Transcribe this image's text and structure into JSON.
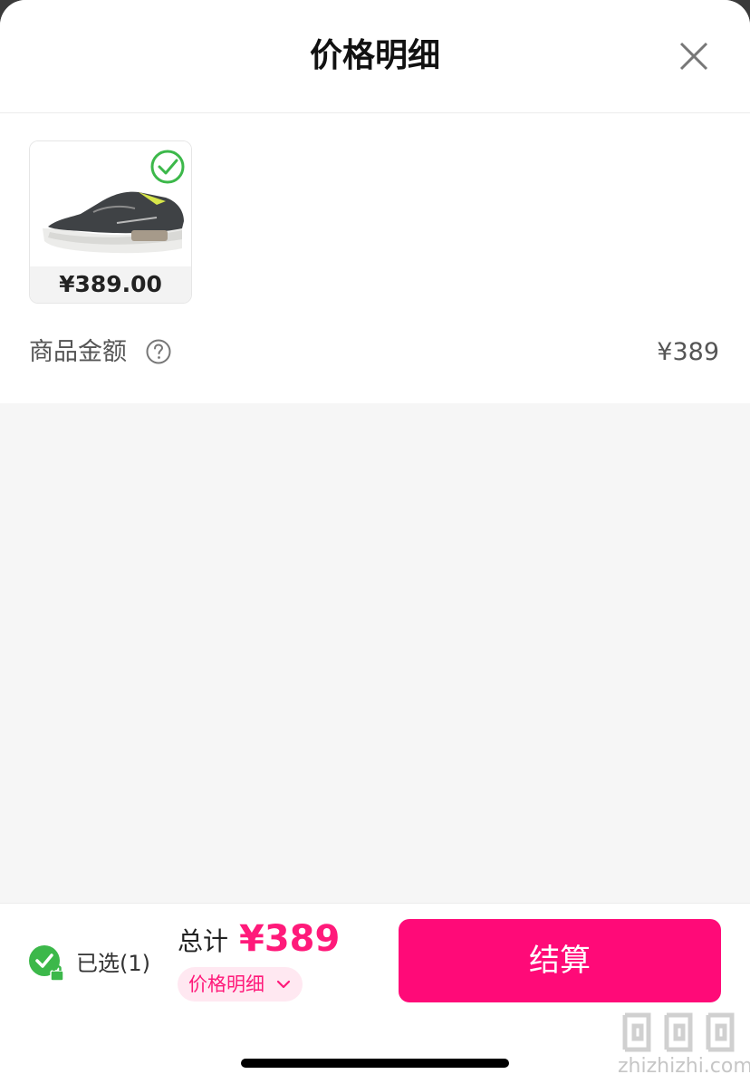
{
  "header": {
    "title": "价格明细"
  },
  "product": {
    "price": "¥389.00",
    "selected": true
  },
  "amount": {
    "label": "商品金额",
    "value": "¥389"
  },
  "footer": {
    "selected_label": "已选(1)",
    "total_label": "总计",
    "total_value": "¥389",
    "detail_label": "价格明细",
    "checkout_label": "结算"
  },
  "watermark": {
    "text": "zhizhizhi.com"
  },
  "colors": {
    "accent": "#ff0a78",
    "check": "#3cb84a",
    "background": "#f6f6f6"
  },
  "icons": [
    "close-icon",
    "check-circle-icon",
    "help-circle-icon",
    "lock-check-icon",
    "chevron-down-icon"
  ]
}
